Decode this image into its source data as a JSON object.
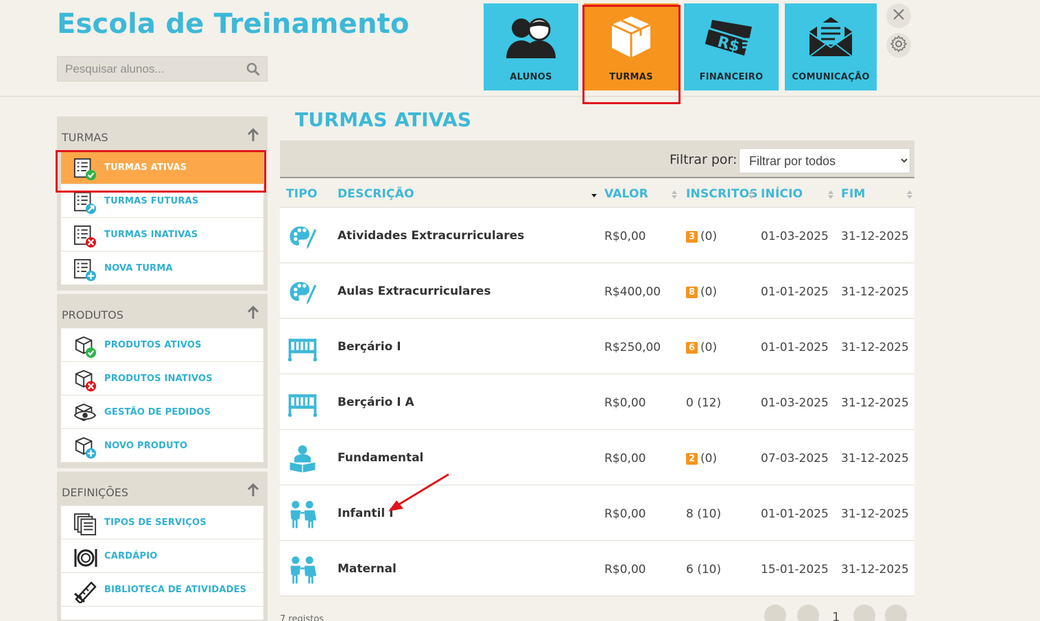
{
  "header": {
    "title": "Escola de Treinamento",
    "search_placeholder": "Pesquisar alunos..."
  },
  "nav": {
    "tiles": [
      {
        "label": "ALUNOS",
        "icon": "students-icon"
      },
      {
        "label": "TURMAS",
        "icon": "box-icon",
        "active": true
      },
      {
        "label": "FINANCEIRO",
        "icon": "money-icon"
      },
      {
        "label": "COMUNICAÇÃO",
        "icon": "envelope-icon"
      }
    ]
  },
  "sidebar": {
    "sections": [
      {
        "title": "TURMAS",
        "items": [
          {
            "label": "TURMAS ATIVAS",
            "active": true
          },
          {
            "label": "TURMAS FUTURAS"
          },
          {
            "label": "TURMAS INATIVAS"
          },
          {
            "label": "NOVA TURMA"
          }
        ]
      },
      {
        "title": "PRODUTOS",
        "items": [
          {
            "label": "PRODUTOS ATIVOS"
          },
          {
            "label": "PRODUTOS INATIVOS"
          },
          {
            "label": "GESTÃO DE PEDIDOS"
          },
          {
            "label": "NOVO PRODUTO"
          }
        ]
      },
      {
        "title": "DEFINIÇÕES",
        "items": [
          {
            "label": "TIPOS DE SERVIÇOS"
          },
          {
            "label": "CARDÁPIO"
          },
          {
            "label": "BIBLIOTECA DE ATIVIDADES"
          }
        ]
      }
    ]
  },
  "main": {
    "title": "TURMAS ATIVAS",
    "filter_label": "Filtrar por:",
    "filter_value": "Filtrar por todos",
    "columns": [
      "TIPO",
      "DESCRIÇÃO",
      "VALOR",
      "INSCRITOS",
      "INÍCIO",
      "FIM"
    ],
    "rows": [
      {
        "icon": "palette-icon",
        "desc": "Atividades Extracurriculares",
        "valor": "R$0,00",
        "badge": "3",
        "insc": "(0)",
        "inicio": "01-03-2025",
        "fim": "31-12-2025"
      },
      {
        "icon": "palette-icon",
        "desc": "Aulas Extracurriculares",
        "valor": "R$400,00",
        "badge": "8",
        "insc": "(0)",
        "inicio": "01-01-2025",
        "fim": "31-12-2025"
      },
      {
        "icon": "crib-icon",
        "desc": "Berçário I",
        "valor": "R$250,00",
        "badge": "6",
        "insc": "(0)",
        "inicio": "01-01-2025",
        "fim": "31-12-2025"
      },
      {
        "icon": "crib-icon",
        "desc": "Berçário I A",
        "valor": "R$0,00",
        "badge": "",
        "insc": "0 (12)",
        "inicio": "01-03-2025",
        "fim": "31-12-2025"
      },
      {
        "icon": "reader-icon",
        "desc": "Fundamental",
        "valor": "R$0,00",
        "badge": "2",
        "insc": "(0)",
        "inicio": "07-03-2025",
        "fim": "31-12-2025"
      },
      {
        "icon": "children-icon",
        "desc": "Infantil I",
        "valor": "R$0,00",
        "badge": "",
        "insc": "8 (10)",
        "inicio": "01-01-2025",
        "fim": "31-12-2025"
      },
      {
        "icon": "children-icon",
        "desc": "Maternal",
        "valor": "R$0,00",
        "badge": "",
        "insc": "6 (10)",
        "inicio": "15-01-2025",
        "fim": "31-12-2025"
      }
    ],
    "records": "7 registos",
    "page": "1"
  }
}
